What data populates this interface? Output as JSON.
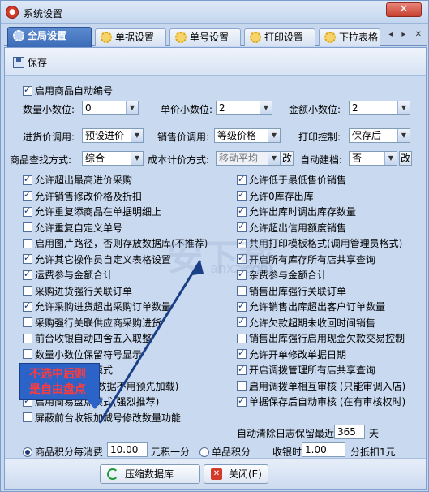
{
  "window": {
    "title": "系统设置",
    "close_glyph": "✕"
  },
  "tabs": [
    {
      "label": "全局设置",
      "active": true
    },
    {
      "label": "单据设置"
    },
    {
      "label": "单号设置"
    },
    {
      "label": "打印设置"
    },
    {
      "label": "下拉表格"
    }
  ],
  "tab_nav": "◂ ▸ ✕",
  "toolbar": {
    "save_label": "保存"
  },
  "auto_code": {
    "label": "启用商品自动编号",
    "checked": true
  },
  "decimals": {
    "qty_label": "数量小数位:",
    "qty_value": "0",
    "price_label": "单价小数位:",
    "price_value": "2",
    "amount_label": "金额小数位:",
    "amount_value": "2"
  },
  "row2": {
    "purchase_price_label": "进货价调用:",
    "purchase_price_value": "预设进价",
    "sale_price_label": "销售价调用:",
    "sale_price_value": "等级价格",
    "print_label": "打印控制:",
    "print_value": "保存后"
  },
  "row3": {
    "search_label": "商品查找方式:",
    "search_value": "综合",
    "cost_label": "成本计价方式:",
    "cost_value": "移动平均",
    "cost_change": "改",
    "auto_build_label": "自动建档:",
    "auto_build_value": "否",
    "auto_build_change": "改"
  },
  "options_left": [
    {
      "label": "允许超出最高进价采购",
      "checked": true
    },
    {
      "label": "允许销售修改价格及折扣",
      "checked": true
    },
    {
      "label": "允许重复添商品在单据明细上",
      "checked": true
    },
    {
      "label": "允许重复自定义单号",
      "checked": false
    },
    {
      "label": "启用图片路径，否则存放数据库(不推荐)",
      "checked": false
    },
    {
      "label": "允许其它操作员自定义表格设置",
      "checked": true
    },
    {
      "label": "运费参与金额合计",
      "checked": true
    },
    {
      "label": "采购进货强行关联订单",
      "checked": false
    },
    {
      "label": "允许采购进货超出采购订单数量",
      "checked": true
    },
    {
      "label": "采购强行关联供应商采购进货",
      "checked": false
    },
    {
      "label": "前台收银自动四舍五入取整",
      "checked": false
    },
    {
      "label": "数量小数位保留符号显示",
      "checked": false
    },
    {
      "label": "启用前台收银模式",
      "checked": false
    },
    {
      "label": "启用商品数量(数据不用预先加载)",
      "checked": false
    },
    {
      "label": "启用简易盘点模式(强烈推荐)",
      "checked": true
    },
    {
      "label": "屏蔽前台收银加减号修改数量功能",
      "checked": false
    }
  ],
  "options_right": [
    {
      "label": "允许低于最低售价销售",
      "checked": true
    },
    {
      "label": "允许0库存出库",
      "checked": true
    },
    {
      "label": "允许出库时调出库存数量",
      "checked": true
    },
    {
      "label": "允许超出信用额度销售",
      "checked": true
    },
    {
      "label": "共用打印模板格式(调用管理员格式)",
      "checked": true
    },
    {
      "label": "开启所有库存所有店共享查询",
      "checked": true
    },
    {
      "label": "杂费参与金额合计",
      "checked": true
    },
    {
      "label": "销售出库强行关联订单",
      "checked": false
    },
    {
      "label": "允许销售出库超出客户订单数量",
      "checked": true
    },
    {
      "label": "允许欠款超期未收回时间销售",
      "checked": true
    },
    {
      "label": "销售出库强行启用现金欠款交易控制",
      "checked": false
    },
    {
      "label": "允许开单修改单据日期",
      "checked": true
    },
    {
      "label": "开启调拨管理所有店共享查询",
      "checked": true
    },
    {
      "label": "启用调拨单相互审核 (只能审调入店)",
      "checked": false
    },
    {
      "label": "单据保存后自动审核 (在有审核权时)",
      "checked": true
    }
  ],
  "auto_clear": {
    "label": "自动清除日志保留最近",
    "value": "365",
    "unit": "天"
  },
  "points": {
    "radio1_label": "商品积分每消费",
    "value1": "10.00",
    "unit1": "元积一分",
    "radio2_label": "单品积分",
    "cash_label": "收银时",
    "value2": "1.00",
    "unit2": "分抵扣1元"
  },
  "buttons": {
    "compress": "压缩数据库",
    "close": "关闭(E)"
  },
  "callout": {
    "line1": "不选中后则",
    "line2": "是自由盘点"
  },
  "watermark": {
    "big": "安下载",
    "small": "anxz.com"
  },
  "colors": {
    "accent": "#3c6cb8",
    "callout_bg": "#2c63c8",
    "callout_text": "#ff3b3b"
  }
}
